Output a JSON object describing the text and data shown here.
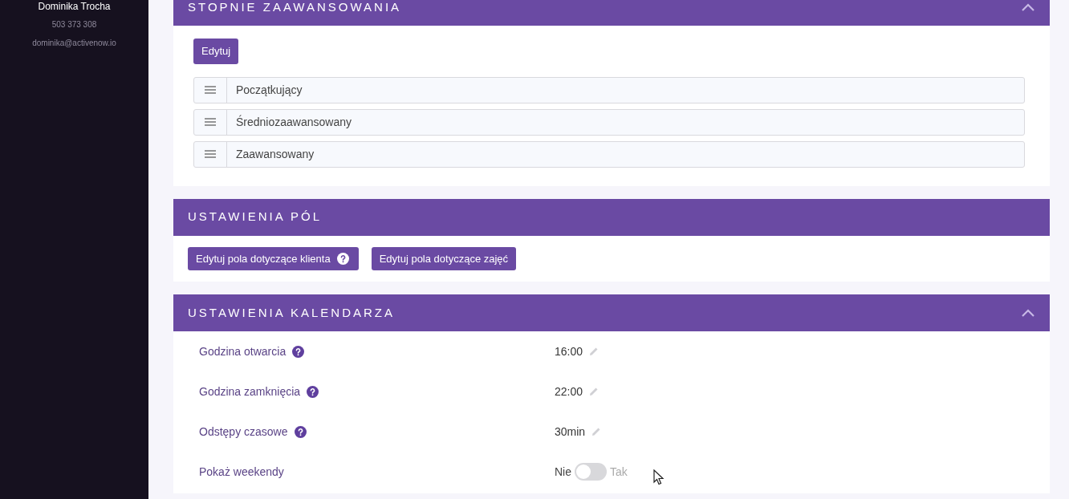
{
  "sidebar": {
    "user_name": "Dominika Trocha",
    "phone": "503 373 308",
    "email": "dominika@activenow.io"
  },
  "sections": [
    {
      "kind": "levels",
      "title": "STOPNIE ZAAWANSOWANIA",
      "collapsible": true,
      "edit_button": "Edytuj",
      "items": [
        "Początkujący",
        "Średniozaawansowany",
        "Zaawansowany"
      ]
    },
    {
      "kind": "buttons",
      "title": "USTAWIENIA PÓL",
      "collapsible": false,
      "buttons": [
        {
          "label": "Edytuj pola dotyczące klienta",
          "help": true
        },
        {
          "label": "Edytuj pola dotyczące zajęć",
          "help": false
        }
      ]
    },
    {
      "kind": "settings",
      "title": "USTAWIENIA KALENDARZA",
      "collapsible": true,
      "rows": [
        {
          "kind": "text",
          "label": "Godzina otwarcia",
          "help": true,
          "value": "16:00",
          "editable": true
        },
        {
          "kind": "text",
          "label": "Godzina zamknięcia",
          "help": true,
          "value": "22:00",
          "editable": true
        },
        {
          "kind": "text",
          "label": "Odstępy czasowe",
          "help": true,
          "value": "30min",
          "editable": true
        },
        {
          "kind": "toggle",
          "label": "Pokaż weekendy",
          "help": false,
          "off_label": "Nie",
          "on_label": "Tak",
          "on": false
        }
      ]
    }
  ]
}
